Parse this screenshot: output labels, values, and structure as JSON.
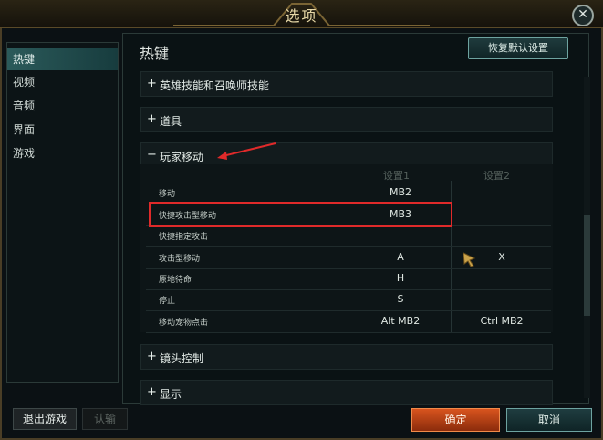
{
  "window": {
    "title": "选项",
    "close_label": "✕"
  },
  "sidebar": {
    "items": [
      {
        "label": "热键",
        "active": true
      },
      {
        "label": "视频",
        "active": false
      },
      {
        "label": "音频",
        "active": false
      },
      {
        "label": "界面",
        "active": false
      },
      {
        "label": "游戏",
        "active": false
      }
    ]
  },
  "main": {
    "title": "热键",
    "restore_label": "恢复默认设置",
    "sections": [
      {
        "sign": "+",
        "label": "英雄技能和召唤师技能"
      },
      {
        "sign": "+",
        "label": "道具"
      },
      {
        "sign": "−",
        "label": "玩家移动"
      },
      {
        "sign": "+",
        "label": "镜头控制"
      },
      {
        "sign": "+",
        "label": "显示"
      }
    ],
    "table": {
      "headers": [
        "设置1",
        "设置2"
      ],
      "rows": [
        {
          "action": "移动",
          "set1": "MB2",
          "set2": ""
        },
        {
          "action": "快捷攻击型移动",
          "set1": "MB3",
          "set2": ""
        },
        {
          "action": "快捷指定攻击",
          "set1": "",
          "set2": ""
        },
        {
          "action": "攻击型移动",
          "set1": "A",
          "set2": "X"
        },
        {
          "action": "原地待命",
          "set1": "H",
          "set2": ""
        },
        {
          "action": "停止",
          "set1": "S",
          "set2": ""
        },
        {
          "action": "移动宠物点击",
          "set1": "Alt  MB2",
          "set2": "Ctrl  MB2"
        }
      ]
    }
  },
  "footer": {
    "exit_label": "退出游戏",
    "surrender_label": "认输",
    "ok_label": "确定",
    "cancel_label": "取消"
  },
  "colors": {
    "accent": "#2b5a5a",
    "highlight": "#e02a2a",
    "ok": "#d8541e"
  },
  "icons": [
    "close-icon",
    "arrow-annotation",
    "mouse-cursor-icon"
  ]
}
